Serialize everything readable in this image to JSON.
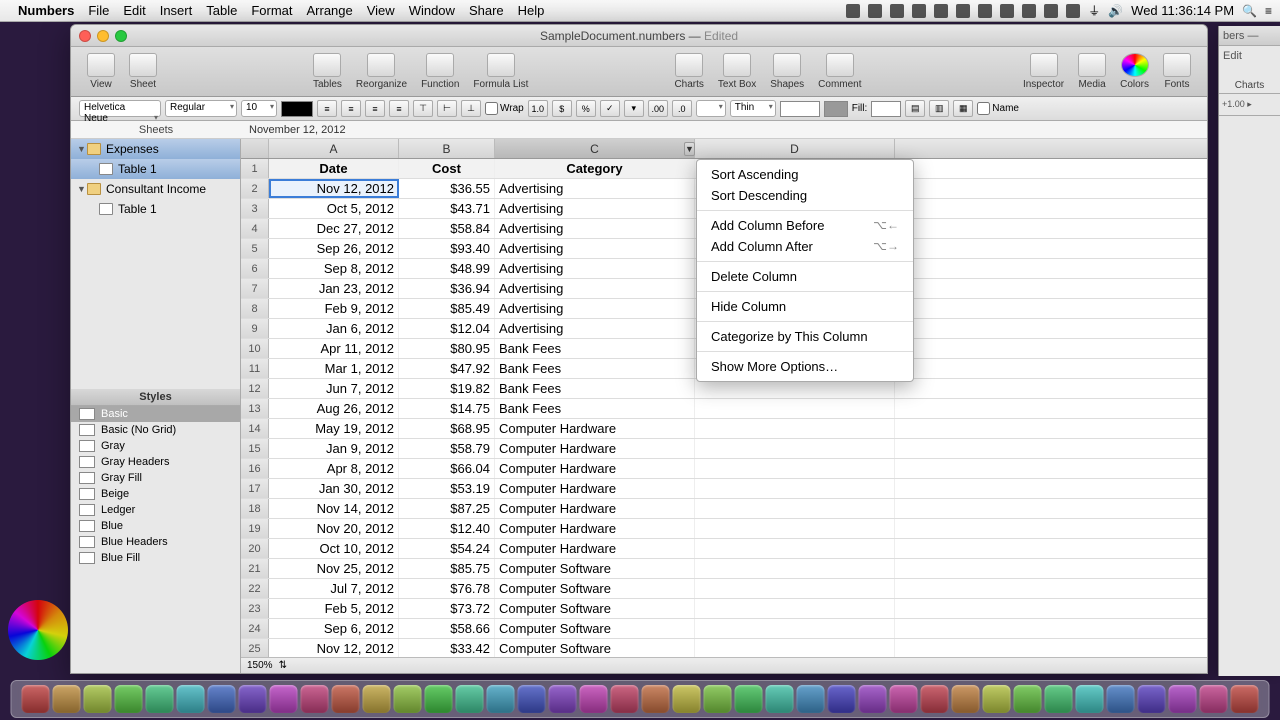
{
  "menubar": {
    "app": "Numbers",
    "items": [
      "File",
      "Edit",
      "Insert",
      "Table",
      "Format",
      "Arrange",
      "View",
      "Window",
      "Share",
      "Help"
    ],
    "clock": "Wed 11:36:14 PM"
  },
  "window": {
    "title": "SampleDocument.numbers",
    "edited": "Edited"
  },
  "toolbar": {
    "items_left": [
      "View",
      "Sheet"
    ],
    "items_mid": [
      "Tables",
      "Reorganize",
      "Function",
      "Formula List"
    ],
    "items_mid2": [
      "Charts",
      "Text Box",
      "Shapes",
      "Comment"
    ],
    "items_right": [
      "Inspector",
      "Media",
      "Colors",
      "Fonts"
    ]
  },
  "formatbar": {
    "font": "Helvetica Neue",
    "weight": "Regular",
    "size": "10",
    "wrap": "Wrap",
    "stroke": "Thin",
    "fill": "Fill:",
    "name": "Name"
  },
  "formula": {
    "header": "Sheets",
    "content": "November 12, 2012"
  },
  "sidebar": {
    "sheets_header": "Sheets",
    "sheets": [
      {
        "name": "Expenses",
        "children": [
          "Table 1"
        ],
        "selected_child": true
      },
      {
        "name": "Consultant Income",
        "children": [
          "Table 1"
        ]
      }
    ],
    "styles_header": "Styles",
    "styles": [
      "Basic",
      "Basic (No Grid)",
      "Gray",
      "Gray Headers",
      "Gray Fill",
      "Beige",
      "Ledger",
      "Blue",
      "Blue Headers",
      "Blue Fill"
    ],
    "selected_style": "Basic"
  },
  "sheet": {
    "columns": [
      "A",
      "B",
      "C",
      "D"
    ],
    "header_row": [
      "Date",
      "Cost",
      "Category",
      ""
    ],
    "rows": [
      [
        "Nov 12, 2012",
        "$36.55",
        "Advertising",
        ""
      ],
      [
        "Oct 5, 2012",
        "$43.71",
        "Advertising",
        ""
      ],
      [
        "Dec 27, 2012",
        "$58.84",
        "Advertising",
        ""
      ],
      [
        "Sep 26, 2012",
        "$93.40",
        "Advertising",
        ""
      ],
      [
        "Sep 8, 2012",
        "$48.99",
        "Advertising",
        ""
      ],
      [
        "Jan 23, 2012",
        "$36.94",
        "Advertising",
        ""
      ],
      [
        "Feb 9, 2012",
        "$85.49",
        "Advertising",
        ""
      ],
      [
        "Jan 6, 2012",
        "$12.04",
        "Advertising",
        ""
      ],
      [
        "Apr 11, 2012",
        "$80.95",
        "Bank Fees",
        ""
      ],
      [
        "Mar 1, 2012",
        "$47.92",
        "Bank Fees",
        ""
      ],
      [
        "Jun 7, 2012",
        "$19.82",
        "Bank Fees",
        ""
      ],
      [
        "Aug 26, 2012",
        "$14.75",
        "Bank Fees",
        ""
      ],
      [
        "May 19, 2012",
        "$68.95",
        "Computer Hardware",
        ""
      ],
      [
        "Jan 9, 2012",
        "$58.79",
        "Computer Hardware",
        ""
      ],
      [
        "Apr 8, 2012",
        "$66.04",
        "Computer Hardware",
        ""
      ],
      [
        "Jan 30, 2012",
        "$53.19",
        "Computer Hardware",
        ""
      ],
      [
        "Nov 14, 2012",
        "$87.25",
        "Computer Hardware",
        ""
      ],
      [
        "Nov 20, 2012",
        "$12.40",
        "Computer Hardware",
        ""
      ],
      [
        "Oct 10, 2012",
        "$54.24",
        "Computer Hardware",
        ""
      ],
      [
        "Nov 25, 2012",
        "$85.75",
        "Computer Software",
        ""
      ],
      [
        "Jul 7, 2012",
        "$76.78",
        "Computer Software",
        ""
      ],
      [
        "Feb 5, 2012",
        "$73.72",
        "Computer Software",
        ""
      ],
      [
        "Sep 6, 2012",
        "$58.66",
        "Computer Software",
        ""
      ],
      [
        "Nov 12, 2012",
        "$33.42",
        "Computer Software",
        ""
      ]
    ],
    "zoom": "150%",
    "selected_cell": {
      "row": 0,
      "col": 0
    }
  },
  "context_menu": {
    "items": [
      {
        "label": "Sort Ascending"
      },
      {
        "label": "Sort Descending"
      },
      {
        "sep": true
      },
      {
        "label": "Add Column Before",
        "kb": "⌥←"
      },
      {
        "label": "Add Column After",
        "kb": "⌥→"
      },
      {
        "sep": true
      },
      {
        "label": "Delete Column"
      },
      {
        "sep": true
      },
      {
        "label": "Hide Column"
      },
      {
        "sep": true
      },
      {
        "label": "Categorize by This Column"
      },
      {
        "sep": true
      },
      {
        "label": "Show More Options…"
      }
    ]
  },
  "window2": {
    "title": "bers — Edit",
    "tb": "Charts",
    "fb": "+1.00 ▸"
  }
}
